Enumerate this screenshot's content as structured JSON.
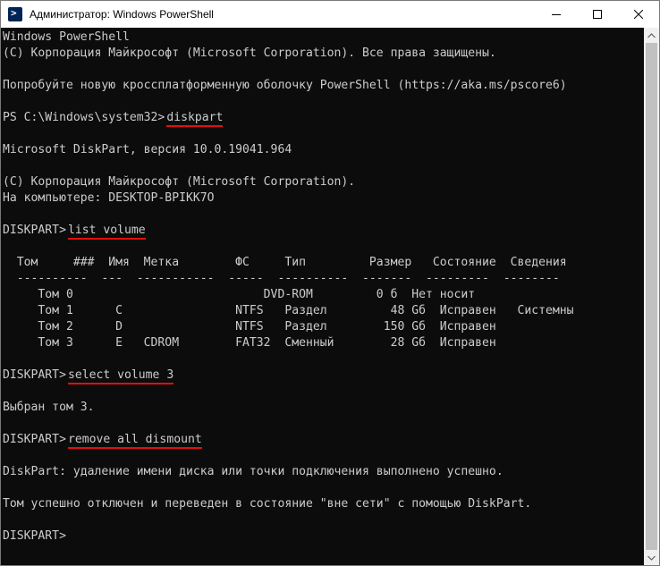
{
  "window": {
    "title": "Администратор: Windows PowerShell",
    "colors": {
      "background": "#0c0c0c",
      "text": "#cccccc",
      "underline": "#e30f0f"
    }
  },
  "console": {
    "line_01": "Windows PowerShell",
    "line_02": "(С) Корпорация Майкрософт (Microsoft Corporation). Все права защищены.",
    "line_03": "",
    "line_04": "Попробуйте новую кроссплатформенную оболочку PowerShell (https://aka.ms/pscore6)",
    "line_05": "",
    "prompt_ps": "PS C:\\Windows\\system32>",
    "cmd_diskpart": "diskpart",
    "line_07": "",
    "line_08": "Microsoft DiskPart, версия 10.0.19041.964",
    "line_09": "",
    "line_10": "(C) Корпорация Майкрософт (Microsoft Corporation).",
    "line_11": "На компьютере: DESKTOP-BPIKK7O",
    "line_12": "",
    "prompt_dp1": "DISKPART>",
    "cmd_list": "list volume",
    "line_14": "",
    "line_15": "  Том     ###  Имя  Метка        ФС     Тип         Размер   Состояние  Сведения",
    "line_16": "  ----------  ---  -----------  -----  ----------  -------  ---------  --------",
    "line_17": "     Том 0                           DVD-ROM         0 б  Нет носит",
    "line_18": "     Том 1      C                NTFS   Раздел         48 Gб  Исправен   Системны",
    "line_19": "     Том 2      D                NTFS   Раздел        150 Gб  Исправен",
    "line_20": "     Том 3      E   CDROM        FAT32  Сменный        28 Gб  Исправен",
    "line_21": "",
    "prompt_dp2": "DISKPART>",
    "cmd_select": "select volume 3",
    "line_23": "",
    "line_24": "Выбран том 3.",
    "line_25": "",
    "prompt_dp3": "DISKPART>",
    "cmd_remove": "remove all dismount",
    "line_27": "",
    "line_28": "DiskPart: удаление имени диска или точки подключения выполнено успешно.",
    "line_29": "",
    "line_30": "Том успешно отключен и переведен в состояние \"вне сети\" с помощью DiskPart.",
    "line_31": "",
    "prompt_dp4": "DISKPART>"
  },
  "icons": {
    "app": "powershell-icon",
    "minimize": "minimize-icon",
    "maximize": "maximize-icon",
    "close": "close-icon"
  }
}
